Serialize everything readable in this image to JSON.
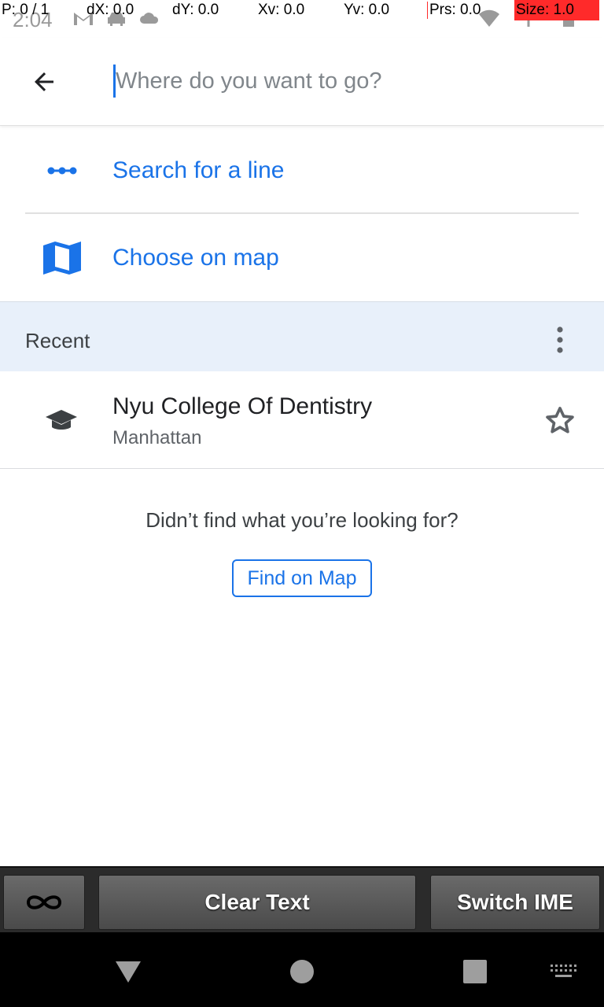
{
  "status_bar": {
    "time": "2:04"
  },
  "debug_overlay": {
    "pointer": "P: 0 / 1",
    "dx": "dX: 0.0",
    "dy": "dY: 0.0",
    "xv": "Xv: 0.0",
    "yv": "Yv: 0.0",
    "prs": "Prs: 0.0",
    "size": "Size: 1.0"
  },
  "search": {
    "placeholder": "Where do you want to go?",
    "value": ""
  },
  "actions": [
    {
      "label": "Search for a line",
      "icon": "transit-line-icon"
    },
    {
      "label": "Choose on map",
      "icon": "map-icon"
    }
  ],
  "recent": {
    "title": "Recent",
    "items": [
      {
        "name": "Nyu College Of Dentistry",
        "subtitle": "Manhattan",
        "icon": "school-icon",
        "starred": false
      }
    ]
  },
  "not_found": {
    "message": "Didn’t find what you’re looking for?",
    "button_label": "Find on Map"
  },
  "keyboard_bar": {
    "loop_icon": "infinity-icon",
    "clear_label": "Clear Text",
    "switch_label": "Switch IME"
  },
  "colors": {
    "accent": "#1a73e8",
    "recent_bg": "#e8f0fa",
    "debug_red": "#ff2a2a"
  }
}
